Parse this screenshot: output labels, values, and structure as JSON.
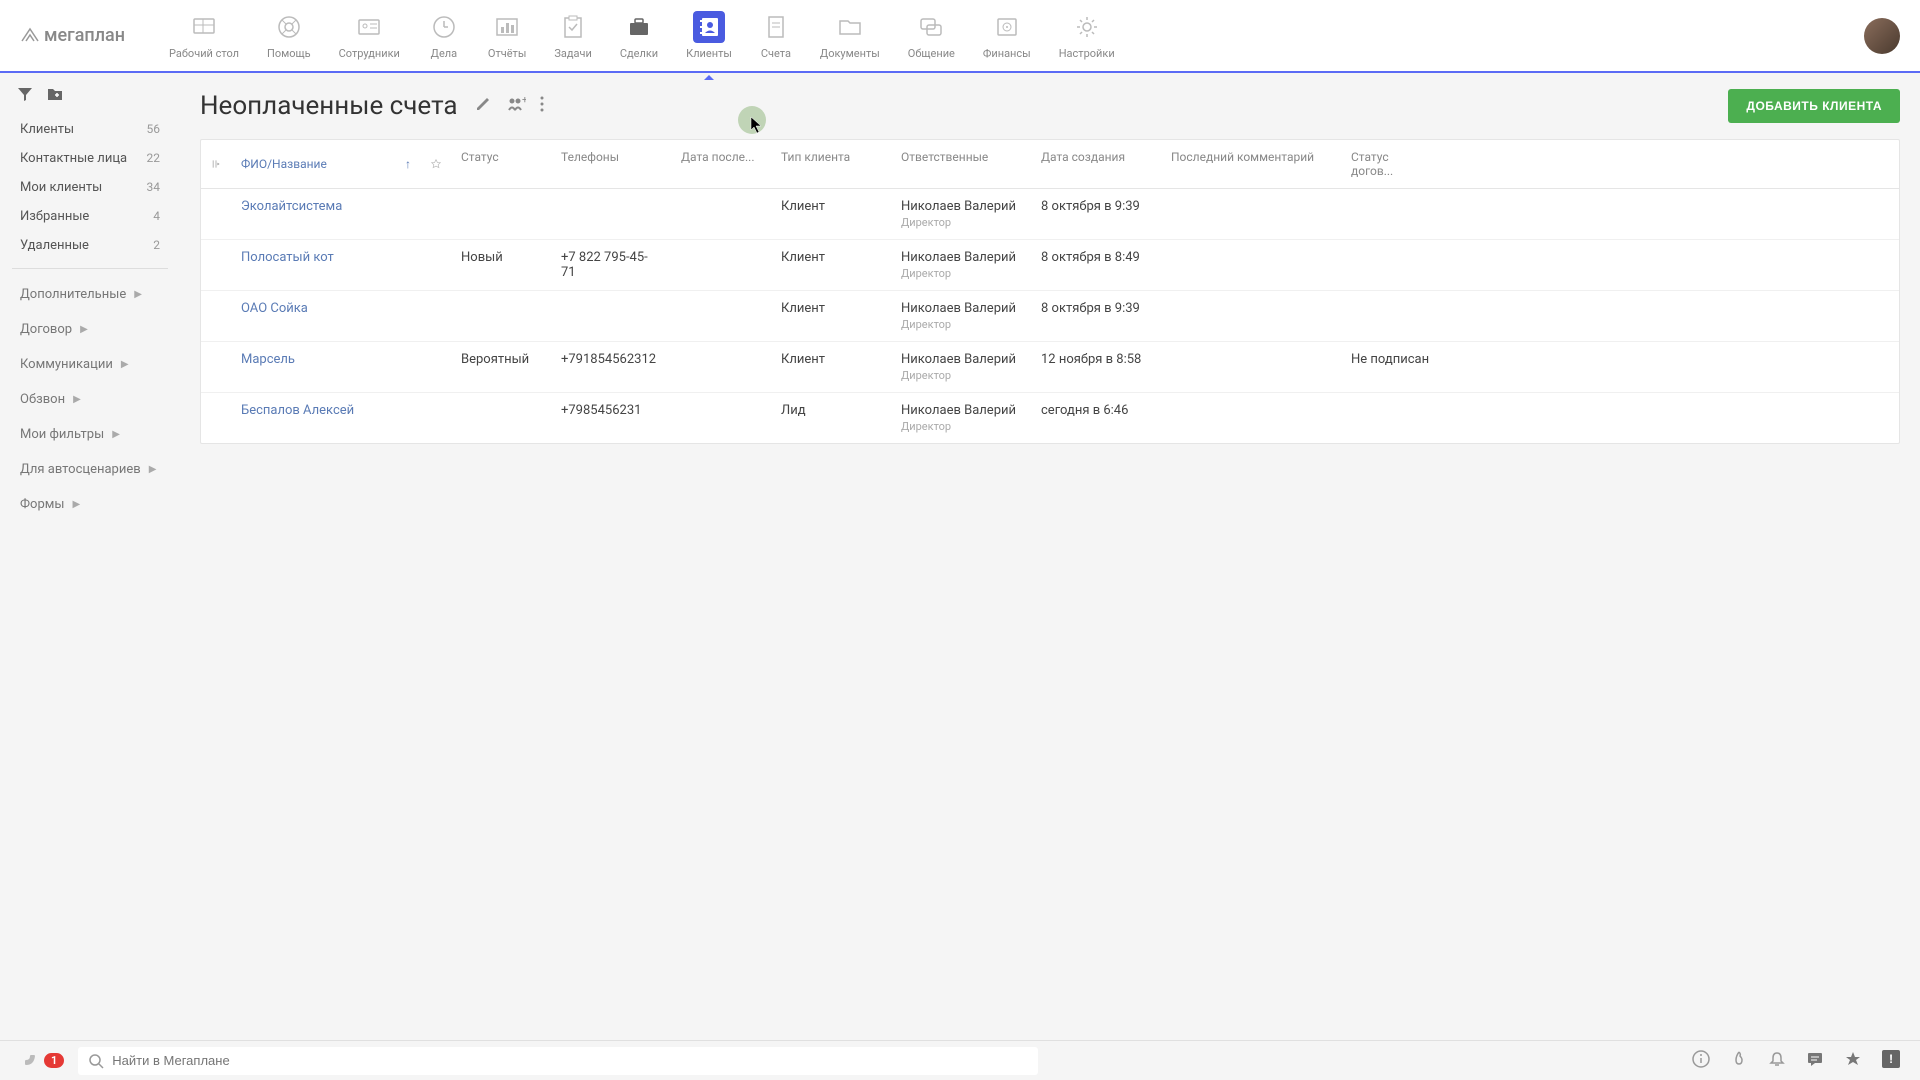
{
  "logo": "мегаплан",
  "nav": [
    {
      "label": "Рабочий стол"
    },
    {
      "label": "Помощь"
    },
    {
      "label": "Сотрудники"
    },
    {
      "label": "Дела"
    },
    {
      "label": "Отчёты"
    },
    {
      "label": "Задачи"
    },
    {
      "label": "Сделки"
    },
    {
      "label": "Клиенты"
    },
    {
      "label": "Счета"
    },
    {
      "label": "Документы"
    },
    {
      "label": "Общение"
    },
    {
      "label": "Финансы"
    },
    {
      "label": "Настройки"
    }
  ],
  "sidebar": {
    "filters": [
      {
        "label": "Клиенты",
        "count": "56"
      },
      {
        "label": "Контактные лица",
        "count": "22"
      },
      {
        "label": "Мои клиенты",
        "count": "34"
      },
      {
        "label": "Избранные",
        "count": "4"
      },
      {
        "label": "Удаленные",
        "count": "2"
      }
    ],
    "sections": [
      {
        "label": "Дополнительные"
      },
      {
        "label": "Договор"
      },
      {
        "label": "Коммуникации"
      },
      {
        "label": "Обзвон"
      },
      {
        "label": "Мои фильтры"
      },
      {
        "label": "Для автосценариев"
      },
      {
        "label": "Формы"
      }
    ]
  },
  "page": {
    "title": "Неоплаченные счета",
    "add_button": "ДОБАВИТЬ КЛИЕНТА"
  },
  "columns": {
    "name": "ФИО/Название",
    "status": "Статус",
    "phone": "Телефоны",
    "date_after": "Дата после...",
    "type": "Тип клиента",
    "responsible": "Ответственные",
    "created": "Дата создания",
    "comment": "Последний комментарий",
    "contract": "Статус догов..."
  },
  "rows": [
    {
      "name": "Эколайтсистема",
      "status": "",
      "phone": "",
      "type": "Клиент",
      "resp": "Николаев Валерий",
      "role": "Директор",
      "created": "8 октября в 9:39",
      "contract": ""
    },
    {
      "name": "Полосатый кот",
      "status": "Новый",
      "phone": "+7 822 795-45-71",
      "type": "Клиент",
      "resp": "Николаев Валерий",
      "role": "Директор",
      "created": "8 октября в 8:49",
      "contract": ""
    },
    {
      "name": "ОАО Сойка",
      "status": "",
      "phone": "",
      "type": "Клиент",
      "resp": "Николаев Валерий",
      "role": "Директор",
      "created": "8 октября в 9:39",
      "contract": ""
    },
    {
      "name": "Марсель",
      "status": "Вероятный",
      "phone": "+791854562312",
      "type": "Клиент",
      "resp": "Николаев Валерий",
      "role": "Директор",
      "created": "12 ноября в 8:58",
      "contract": "Не подписан"
    },
    {
      "name": "Беспалов Алексей",
      "status": "",
      "phone": "+7985456231",
      "type": "Лид",
      "resp": "Николаев Валерий",
      "role": "Директор",
      "created": "сегодня в 6:46",
      "contract": ""
    }
  ],
  "bottom": {
    "phone_badge": "1",
    "search_placeholder": "Найти в Мегаплане"
  }
}
